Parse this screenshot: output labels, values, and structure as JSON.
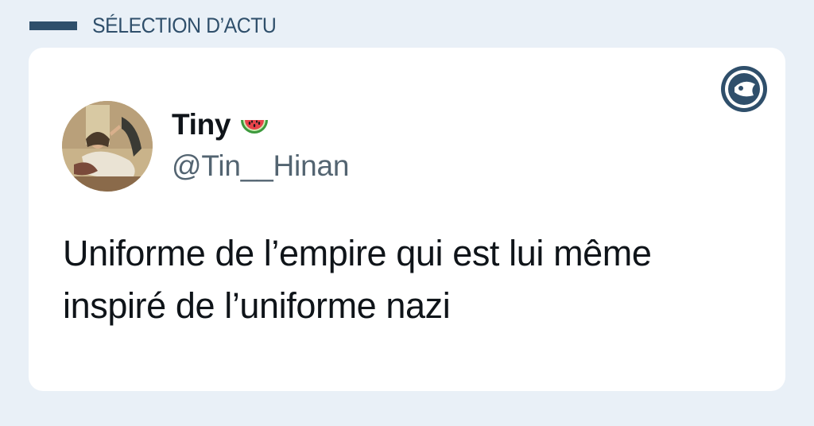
{
  "header": {
    "title": "SÉLECTION D’ACTU"
  },
  "tweet": {
    "display_name": "Tiny",
    "name_emoji": "watermelon-icon",
    "handle": "@Tin__Hinan",
    "text": "Uniforme de l’empire qui est lui même inspiré de l’uniforme nazi"
  },
  "colors": {
    "page_background": "#e9f0f7",
    "accent": "#2f4f6b",
    "handle_gray": "#536471",
    "text_dark": "#0f1419"
  }
}
